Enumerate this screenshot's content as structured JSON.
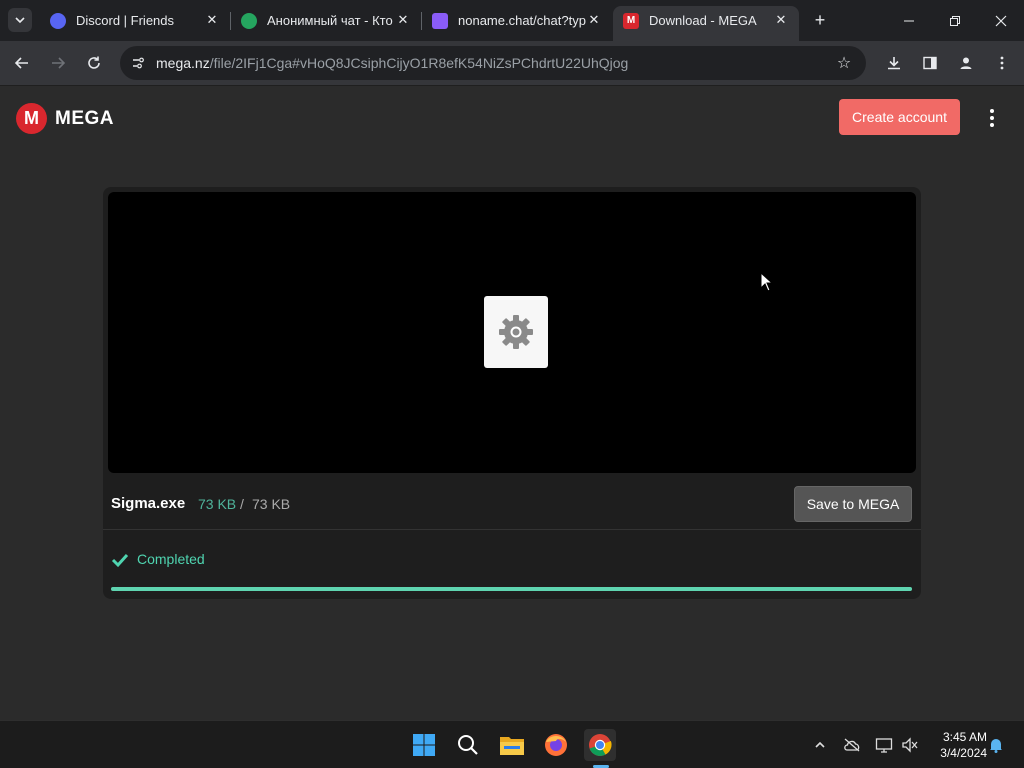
{
  "browser": {
    "tabs": [
      {
        "label": "Discord | Friends",
        "favicon": "discord-icon",
        "active": false
      },
      {
        "label": "Анонимный чат - Кто",
        "favicon": "chat-bubble-icon",
        "active": false
      },
      {
        "label": "noname.chat/chat?typ",
        "favicon": "purple-heart-icon",
        "active": false
      },
      {
        "label": "Download - MEGA",
        "favicon": "mega-icon",
        "active": true
      }
    ],
    "url_domain": "mega.nz",
    "url_rest": "/file/2IFj1Cga#vHoQ8JCsiphCijyO1R8efK54NiZsPChdrtU22UhQjog"
  },
  "mega": {
    "logo_text": "MEGA",
    "create_account_label": "Create account",
    "file_name": "Sigma.exe",
    "size_downloaded": "73 KB",
    "size_separator": "/",
    "size_total": "73 KB",
    "save_button_label": "Save to MEGA",
    "status_text": "Completed",
    "progress_fraction": 1.0
  },
  "taskbar": {
    "time": "3:45 AM",
    "date": "3/4/2024",
    "apps": [
      "windows-start-icon",
      "search-icon",
      "file-explorer-icon",
      "firefox-icon",
      "chrome-icon"
    ]
  },
  "colors": {
    "mega_red": "#d9272e",
    "create_account_bg": "#f16a66",
    "completed_green": "#4fd4b0"
  }
}
